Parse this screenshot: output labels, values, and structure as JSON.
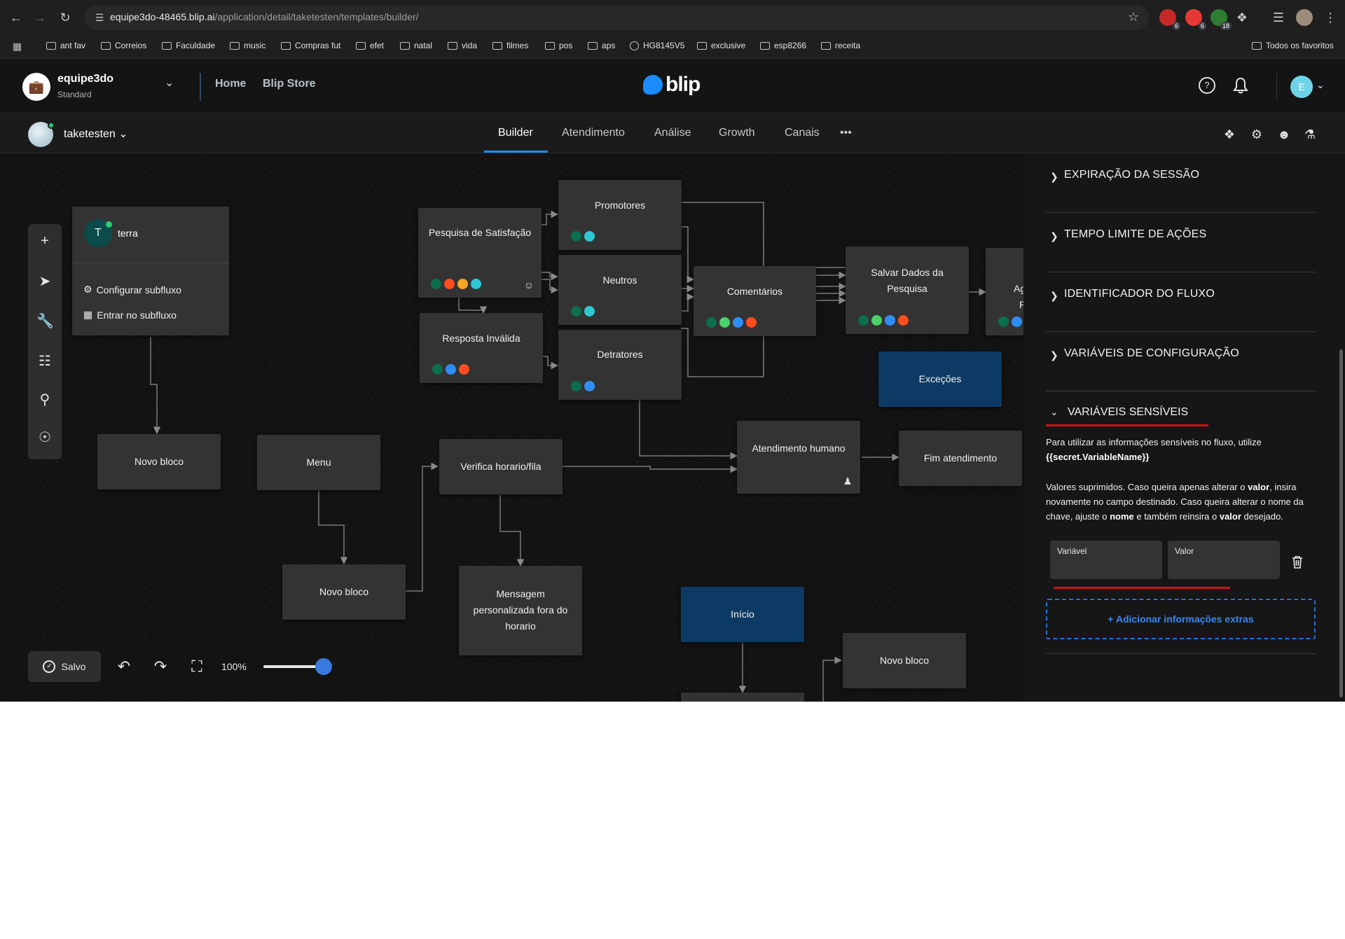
{
  "browser": {
    "url_host": "equipe3do-48465.blip.ai",
    "url_path": "/application/detail/taketesten/templates/builder/",
    "bookmarks": [
      "ant fav",
      "Correios",
      "Faculdade",
      "music",
      "Compras fut",
      "efet",
      "natal",
      "vida",
      "filmes",
      "pos",
      "aps",
      "HG8145V5",
      "exclusive",
      "esp8266",
      "receita"
    ],
    "all_bookmarks": "Todos os favoritos",
    "ext_badges": [
      "6",
      "6",
      "18"
    ]
  },
  "header": {
    "org_initial": "",
    "org_name": "equipe3do",
    "org_plan": "Standard",
    "links": [
      "Home",
      "Blip Store"
    ],
    "logo_text": "blip",
    "user_initial": "E"
  },
  "subnav": {
    "bot_name": "taketesten",
    "tabs": [
      "Builder",
      "Atendimento",
      "Análise",
      "Growth",
      "Canais"
    ],
    "more": "•••"
  },
  "canvas": {
    "subflow": {
      "initial": "T",
      "name": "terra",
      "configure": "Configurar subfluxo",
      "enter": "Entrar no subfluxo"
    },
    "blocks": {
      "pesquisa": "Pesquisa de Satisfação",
      "promotores": "Promotores",
      "neutros": "Neutros",
      "detratores": "Detratores",
      "resposta": "Resposta Inválida",
      "comentarios": "Comentários",
      "salvar": "Salvar Dados da Pesquisa",
      "partial_a": "Ag",
      "partial_b": "P",
      "excecoes": "Exceções",
      "atendimento": "Atendimento humano",
      "fim": "Fim atendimento",
      "novo1": "Novo bloco",
      "menu": "Menu",
      "verifica": "Verifica horario/fila",
      "novo2": "Novo bloco",
      "mensagem": "Mensagem personalizada fora do horario",
      "inicio": "Início",
      "novo3": "Novo bloco"
    },
    "colors": {
      "green_dark": "#0b6e4f",
      "red": "#ff4d1f",
      "orange": "#f5a623",
      "cyan": "#2ec7d6",
      "blue": "#2f8ef5",
      "green_light": "#4cd26b"
    }
  },
  "controls": {
    "saved": "Salvo",
    "zoom": "100%",
    "zoom_level": 1.0
  },
  "panel": {
    "sections": [
      "EXPIRAÇÃO DA SESSÃO",
      "TEMPO LIMITE DE AÇÕES",
      "IDENTIFICADOR DO FLUXO",
      "VARIÁVEIS DE CONFIGURAÇÃO"
    ],
    "open_section": "VARIÁVEIS SENSÍVEIS",
    "info1_a": "Para utilizar as informações sensíveis no fluxo, utilize ",
    "info1_b": "{{secret.VariableName}}",
    "info2_a": "Valores suprimidos. Caso queira apenas alterar o ",
    "info2_b": "valor",
    "info2_c": ", insira novamente no campo destinado. Caso queira alterar o nome da chave, ajuste o ",
    "info2_d": "nome",
    "info2_e": " e também reinsira o ",
    "info2_f": "valor",
    "info2_g": " desejado.",
    "var_label": "Variável",
    "val_label": "Valor",
    "var_value": "",
    "val_value": "",
    "add_extra": "+ Adicionar informações extras"
  }
}
